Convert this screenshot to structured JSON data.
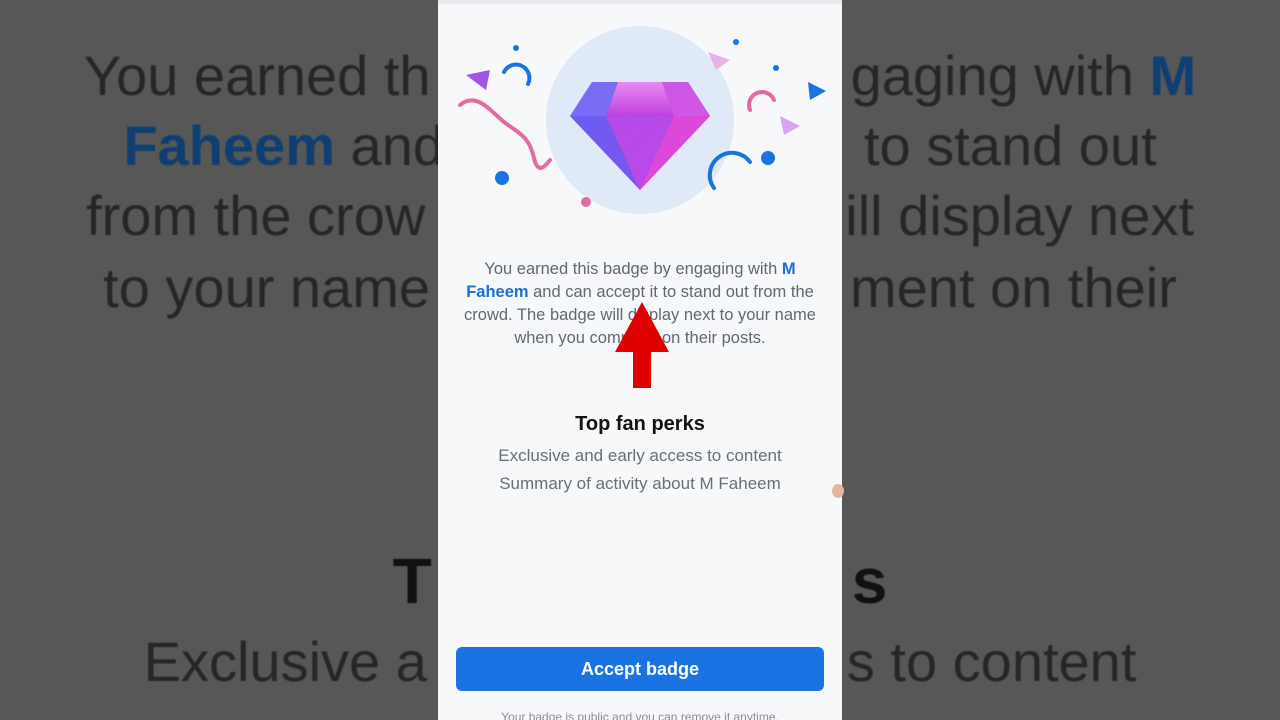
{
  "background": {
    "line1_a": "You earned th",
    "line1_b": "gaging with",
    "line1_name": "M",
    "line2_name": "Faheem",
    "line2_a": "and",
    "line2_b": "to stand out",
    "line3_a": "from the crow",
    "line3_b": "ill display next",
    "line4_a": "to your name",
    "line4_b": "ment on their",
    "perks_title_fragment_left": "T",
    "perks_title_fragment_right": "s",
    "perk_line_a": "Exclusive a",
    "perk_line_b": "s to content"
  },
  "sheet": {
    "description_prefix": "You earned this badge by engaging with ",
    "creator_name": "M Faheem",
    "description_suffix": " and can accept it to stand out from the crowd. The badge will display next to your name when you comment on their posts.",
    "perks_title": "Top fan perks",
    "perks": [
      "Exclusive and early access to content",
      "Summary of activity about M Faheem"
    ],
    "accept_label": "Accept badge",
    "footer_note": "Your badge is public and you can remove it anytime."
  },
  "colors": {
    "accent": "#1a73e3",
    "creator_name": "#1b6fd1",
    "arrow": "#e00000",
    "gem_primary": "#b044e6",
    "gem_secondary": "#6a5cf0"
  },
  "icons": {
    "badge": "diamond-gem-icon",
    "pointer": "red-up-arrow-icon"
  }
}
